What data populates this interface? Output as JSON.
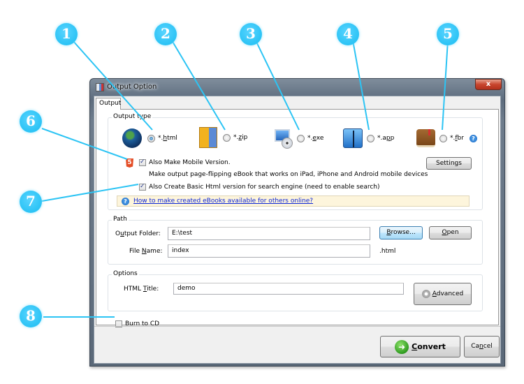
{
  "window": {
    "title": "Output Option",
    "close_label": "x"
  },
  "tabs": [
    {
      "label": "Output",
      "active": true
    }
  ],
  "output_type": {
    "group_title": "Output type",
    "options": [
      {
        "label_pre": "*.",
        "mnemonic": "h",
        "label_post": "tml",
        "icon": "globe-icon",
        "selected": true
      },
      {
        "label_pre": "*.",
        "mnemonic": "z",
        "label_post": "ip",
        "icon": "zip-archive-icon",
        "selected": false
      },
      {
        "label_pre": "*.",
        "mnemonic": "e",
        "label_post": "xe",
        "icon": "computer-cd-icon",
        "selected": false
      },
      {
        "label_pre": "*.a",
        "mnemonic": "p",
        "label_post": "p",
        "icon": "mac-finder-icon",
        "selected": false
      },
      {
        "label_pre": "*.",
        "mnemonic": "f",
        "label_post": "br",
        "icon": "book-icon",
        "selected": false
      }
    ],
    "help_glyph": "?",
    "html5_glyph": "5",
    "mobile_checkbox": {
      "label": "Also Make Mobile Version.",
      "checked": true
    },
    "mobile_description": "Make output page-flipping eBook that works on iPad, iPhone and Android mobile devices",
    "settings_button": "Settings",
    "basic_html_checkbox": {
      "label": "Also Create Basic Html version for search engine (need to enable search)",
      "checked": true
    },
    "info_link": "How to make created eBooks available for others online?"
  },
  "path": {
    "group_title": "Path",
    "output_folder_label_pre": "O",
    "output_folder_label_mn": "u",
    "output_folder_label_post": "tput Folder:",
    "output_folder_value": "E:\\test",
    "browse_pre": "",
    "browse_mn": "B",
    "browse_post": "rowse...",
    "open_pre": "",
    "open_mn": "O",
    "open_post": "pen",
    "file_name_label_pre": "File ",
    "file_name_label_mn": "N",
    "file_name_label_post": "ame:",
    "file_name_value": "index",
    "file_ext": ".html"
  },
  "options": {
    "group_title": "Options",
    "html_title_label_pre": "HTML ",
    "html_title_label_mn": "T",
    "html_title_label_post": "itle:",
    "html_title_value": "demo",
    "advanced_pre": "",
    "advanced_mn": "A",
    "advanced_post": "dvanced"
  },
  "burn_cd": {
    "label_pre": "Bu",
    "label_mn": "r",
    "label_post": "n to CD",
    "checked": false
  },
  "footer": {
    "convert_pre": "",
    "convert_mn": "C",
    "convert_post": "onvert",
    "cancel_pre": "Ca",
    "cancel_mn": "n",
    "cancel_post": "cel"
  },
  "callouts": [
    "1",
    "2",
    "3",
    "4",
    "5",
    "6",
    "7",
    "8"
  ],
  "colors": {
    "callout": "#2bc3f5",
    "link": "#0b24d6",
    "info_bg": "#fdf5dc",
    "close": "#c8452d"
  }
}
